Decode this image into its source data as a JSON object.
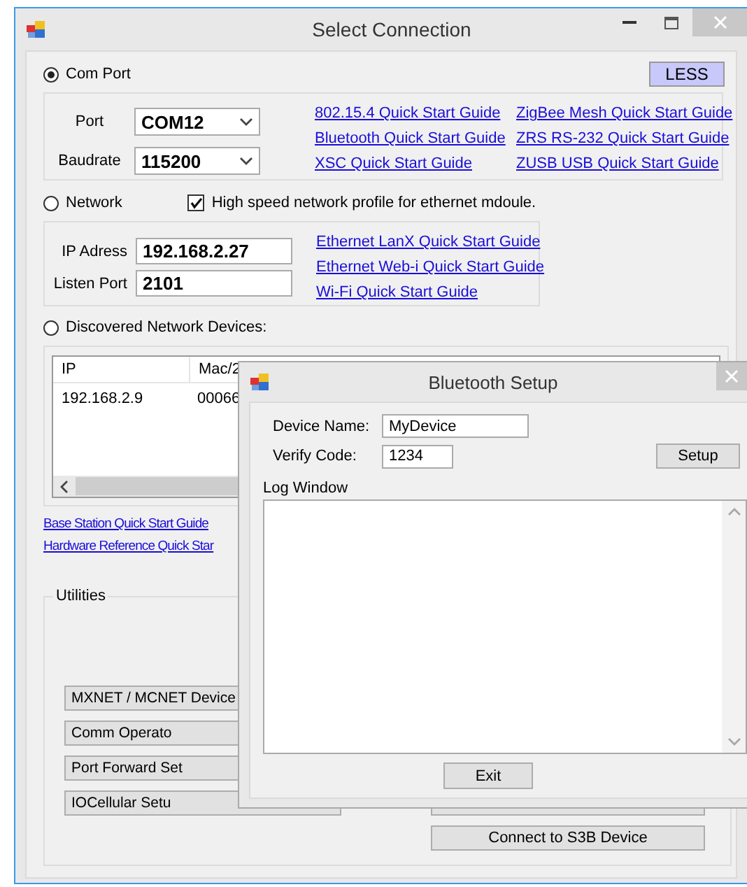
{
  "main_window": {
    "title": "Select Connection",
    "less_button": "LESS",
    "com_port": {
      "label": "Com Port",
      "selected": true,
      "port_label": "Port",
      "port_value": "COM12",
      "baudrate_label": "Baudrate",
      "baudrate_value": "115200",
      "links": [
        "802.15.4 Quick Start Guide",
        "ZigBee Mesh Quick Start Guide",
        "Bluetooth Quick Start Guide",
        "ZRS RS-232 Quick Start Guide",
        "XSC Quick Start Guide",
        "ZUSB USB Quick Start Guide"
      ]
    },
    "network": {
      "label": "Network",
      "selected": false,
      "high_speed": {
        "label": "High speed network profile for ethernet mdoule.",
        "checked": true
      },
      "ip_label": "IP Adress",
      "ip_value": "192.168.2.27",
      "listen_port_label": "Listen Port",
      "listen_port_value": "2101",
      "links": [
        "Ethernet LanX Quick Start Guide",
        "Ethernet Web-i Quick Start Guide",
        "Wi-Fi Quick Start Guide"
      ]
    },
    "discovered": {
      "label": "Discovered Network Devices:",
      "selected": false,
      "columns": [
        "IP",
        "Mac/2"
      ],
      "rows": [
        [
          "192.168.2.9",
          "00066"
        ]
      ]
    },
    "guide_links": [
      "Base Station Quick Start Guide",
      "Hardware Reference Quick Star"
    ],
    "utilities": {
      "title": "Utilities",
      "left_buttons": [
        "MXNET / MCNET Device",
        "Comm Operato",
        "Port Forward Set",
        "IOCellular Setu"
      ],
      "right_buttons": [
        "Connect to S3B Device"
      ]
    }
  },
  "bluetooth_dialog": {
    "title": "Bluetooth Setup",
    "device_name_label": "Device Name:",
    "device_name_value": "MyDevice",
    "verify_code_label": "Verify Code:",
    "verify_code_value": "1234",
    "setup_button": "Setup",
    "log_label": "Log Window",
    "exit_button": "Exit"
  }
}
